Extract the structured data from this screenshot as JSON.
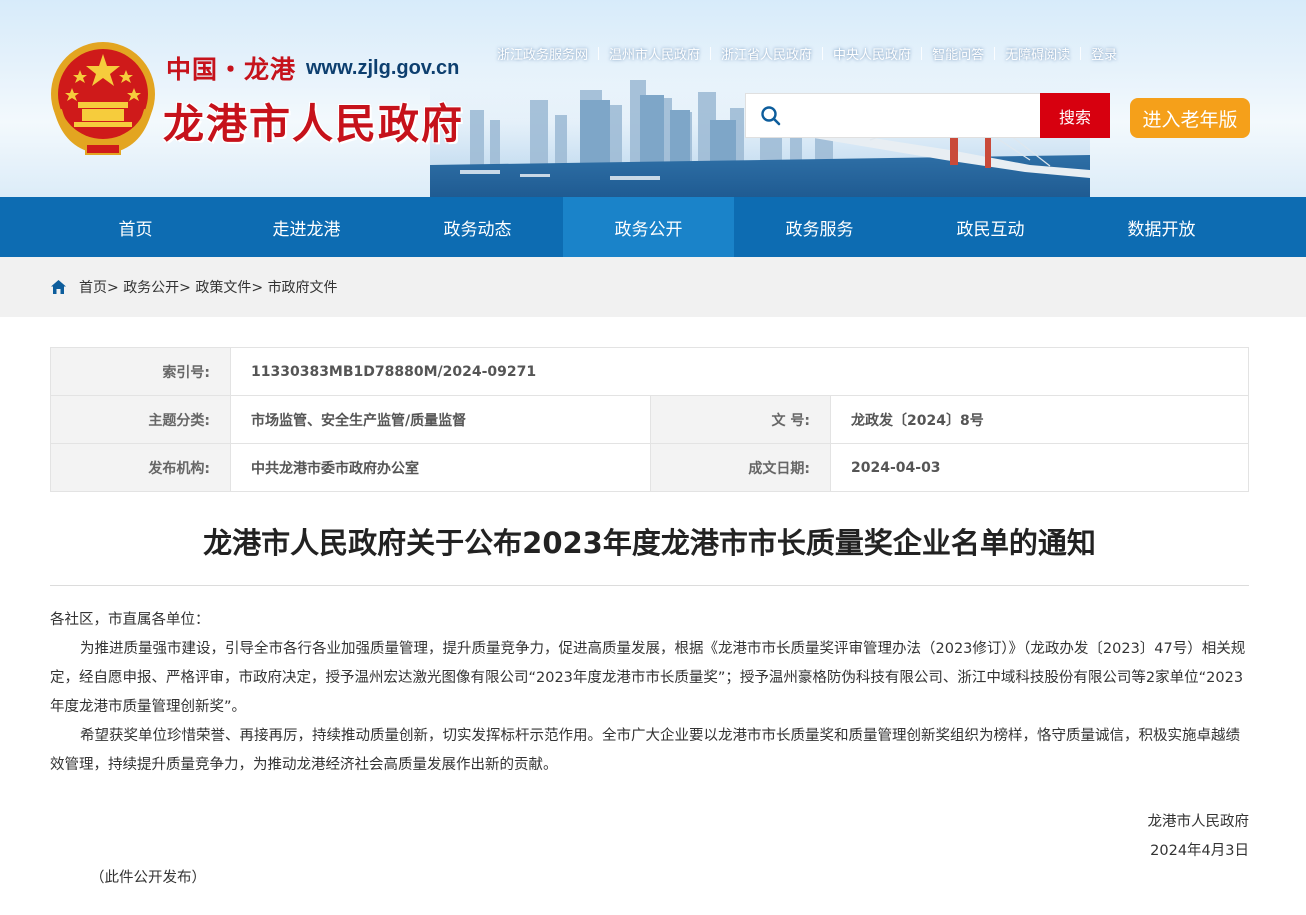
{
  "header": {
    "site_name_cn": "中国・龙港",
    "site_url": "www.zjlg.gov.cn",
    "site_title": "龙港市人民政府",
    "top_links": [
      "浙江政务服务网",
      "温州市人民政府",
      "浙江省人民政府",
      "中央人民政府",
      "智能问答",
      "无障碍阅读",
      "登录"
    ],
    "search": {
      "placeholder": "",
      "button_label": "搜索"
    },
    "elder_mode_label": "进入老年版"
  },
  "nav": {
    "items": [
      "首页",
      "走进龙港",
      "政务动态",
      "政务公开",
      "政务服务",
      "政民互动",
      "数据开放"
    ],
    "active": "政务公开"
  },
  "breadcrumb": [
    "首页>",
    "政务公开>",
    "政策文件>",
    "市政府文件"
  ],
  "meta": {
    "index_label": "索引号:",
    "index_value": "11330383MB1D78880M/2024-09271",
    "topic_label": "主题分类:",
    "topic_value": "市场监管、安全生产监管/质量监督",
    "docno_label": "文 号:",
    "docno_value": "龙政发〔2024〕8号",
    "issuer_label": "发布机构:",
    "issuer_value": "中共龙港市委市政府办公室",
    "date_label": "成文日期:",
    "date_value": "2024-04-03"
  },
  "article": {
    "title": "龙港市人民政府关于公布2023年度龙港市市长质量奖企业名单的通知",
    "salutation": "各社区，市直属各单位：",
    "para1": "为推进质量强市建设，引导全市各行各业加强质量管理，提升质量竞争力，促进高质量发展，根据《龙港市市长质量奖评审管理办法（2023修订）》（龙政办发〔2023〕47号）相关规定，经自愿申报、严格评审，市政府决定，授予温州宏达激光图像有限公司“2023年度龙港市市长质量奖”；授予温州豪格防伪科技有限公司、浙江中域科技股份有限公司等2家单位“2023年度龙港市质量管理创新奖”。",
    "para2": "希望获奖单位珍惜荣誉、再接再厉，持续推动质量创新，切实发挥标杆示范作用。全市广大企业要以龙港市市长质量奖和质量管理创新奖组织为榜样，恪守质量诚信，积极实施卓越绩效管理，持续提升质量竞争力，为推动龙港经济社会高质量发展作出新的贡献。",
    "signature": "龙港市人民政府",
    "sign_date": "2024年4月3日",
    "note": "（此件公开发布）"
  },
  "colors": {
    "brand_red": "#c6121b",
    "nav_blue": "#0d6cb2",
    "nav_active": "#1a83c9",
    "search_red": "#d7000f",
    "elder_orange": "#f5a01a"
  },
  "icons": {
    "emblem": "national-emblem-icon",
    "search": "search-icon",
    "home": "home-icon"
  }
}
